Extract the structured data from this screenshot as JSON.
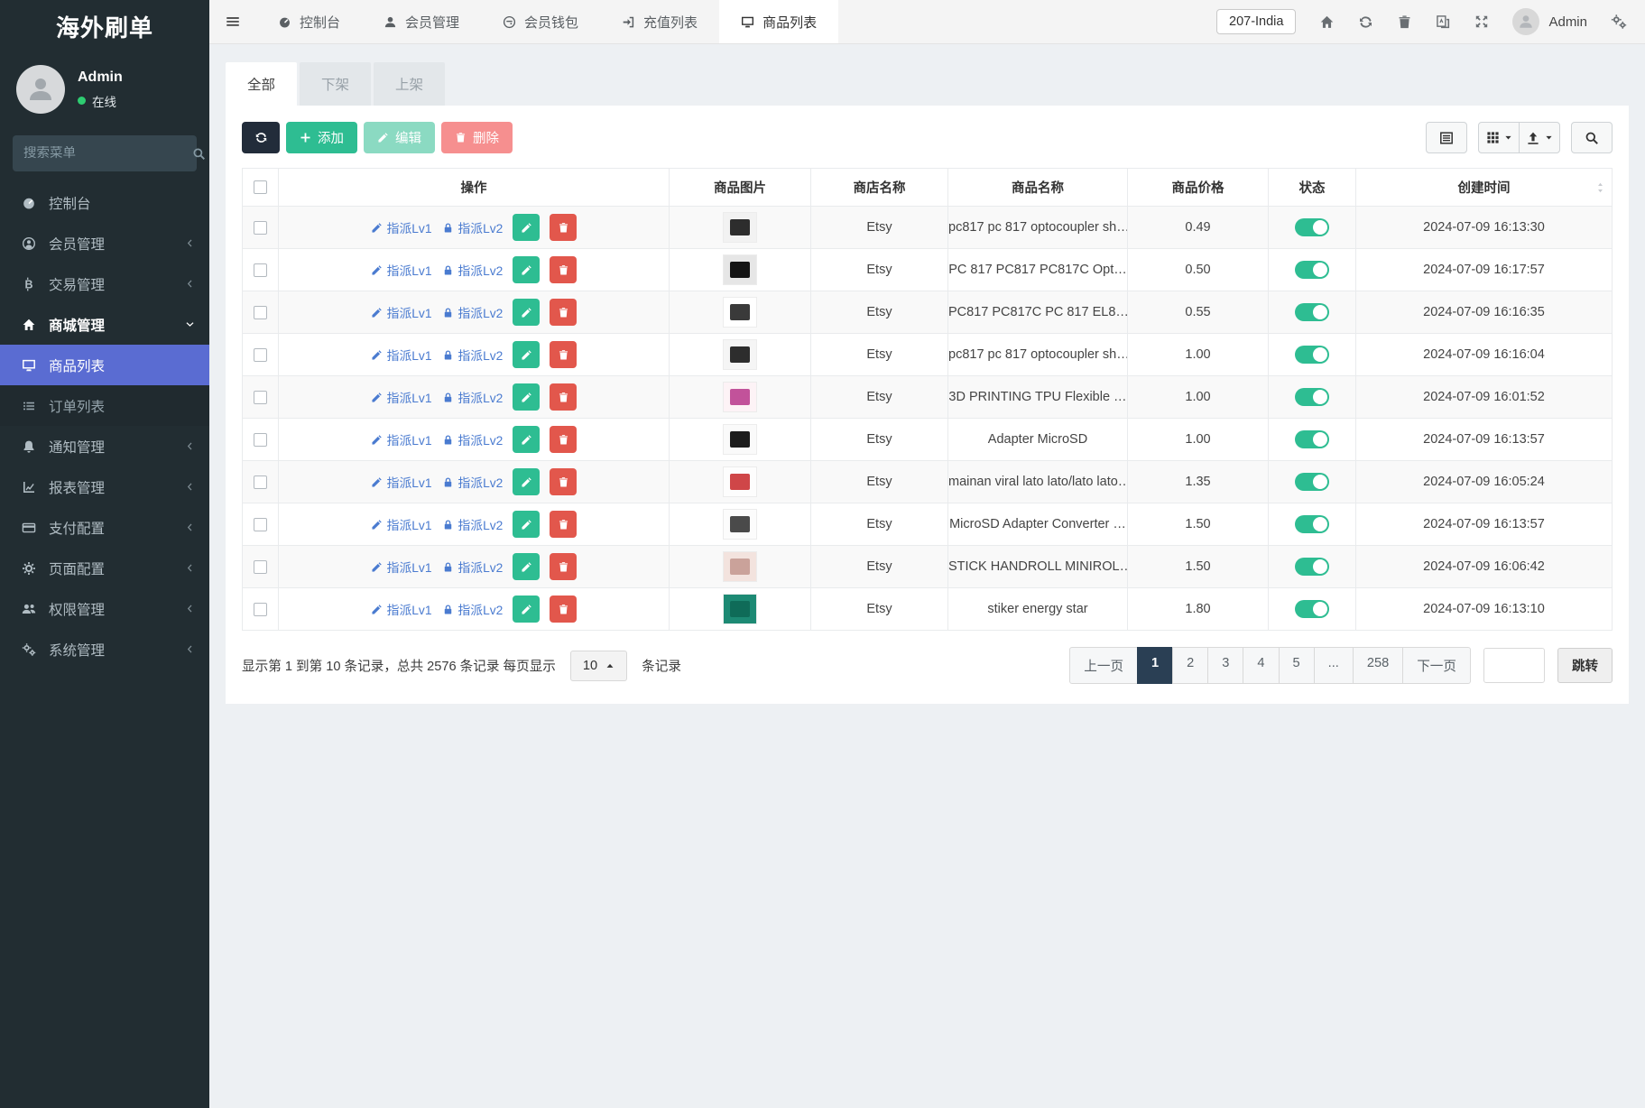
{
  "app": {
    "title": "海外刷单"
  },
  "sidebar": {
    "user": {
      "name": "Admin",
      "status": "在线"
    },
    "search_placeholder": "搜索菜单",
    "items": [
      {
        "label": "控制台",
        "icon": "speedometer-icon"
      },
      {
        "label": "会员管理",
        "icon": "user-circle-icon",
        "chevron": true
      },
      {
        "label": "交易管理",
        "icon": "bitcoin-icon",
        "chevron": true
      },
      {
        "label": "商城管理",
        "icon": "home-icon",
        "expanded": true
      },
      {
        "label": "商品列表",
        "icon": "desktop-icon",
        "active": true
      },
      {
        "label": "订单列表",
        "icon": "list-icon",
        "dim": true
      },
      {
        "label": "通知管理",
        "icon": "bell-icon",
        "chevron": true
      },
      {
        "label": "报表管理",
        "icon": "chart-icon",
        "chevron": true
      },
      {
        "label": "支付配置",
        "icon": "credit-card-icon",
        "chevron": true
      },
      {
        "label": "页面配置",
        "icon": "gear-icon",
        "chevron": true
      },
      {
        "label": "权限管理",
        "icon": "users-icon",
        "chevron": true
      },
      {
        "label": "系统管理",
        "icon": "cogs-icon",
        "chevron": true
      }
    ]
  },
  "topbar": {
    "tabs": [
      {
        "label": "控制台",
        "icon": "speedometer-icon"
      },
      {
        "label": "会员管理",
        "icon": "user-icon"
      },
      {
        "label": "会员钱包",
        "icon": "wallet-icon"
      },
      {
        "label": "充值列表",
        "icon": "signin-icon"
      },
      {
        "label": "商品列表",
        "icon": "desktop-icon",
        "active": true
      }
    ],
    "region": "207-India",
    "user": "Admin"
  },
  "content": {
    "filter_tabs": [
      {
        "label": "全部",
        "active": true
      },
      {
        "label": "下架"
      },
      {
        "label": "上架"
      }
    ],
    "toolbar": {
      "add": "添加",
      "edit": "编辑",
      "delete": "删除"
    },
    "table": {
      "columns": [
        "操作",
        "商品图片",
        "商店名称",
        "商品名称",
        "商品价格",
        "状态",
        "创建时间"
      ],
      "action_labels": {
        "assign1": "指派Lv1",
        "assign2": "指派Lv2"
      },
      "rows": [
        {
          "store": "Etsy",
          "name": "pc817 pc 817 optocoupler sh…",
          "price": "0.49",
          "status": "on",
          "created": "2024-07-09 16:13:30",
          "thumb_bg": "#f2f2f2",
          "thumb_fg": "#2d2d2d"
        },
        {
          "store": "Etsy",
          "name": "PC 817 PC817 PC817C Opt…",
          "price": "0.50",
          "status": "on",
          "created": "2024-07-09 16:17:57",
          "thumb_bg": "#e6e6e6",
          "thumb_fg": "#141414"
        },
        {
          "store": "Etsy",
          "name": "PC817 PC817C PC 817 EL8…",
          "price": "0.55",
          "status": "on",
          "created": "2024-07-09 16:16:35",
          "thumb_bg": "#ffffff",
          "thumb_fg": "#3a3a3a"
        },
        {
          "store": "Etsy",
          "name": "pc817 pc 817 optocoupler sh…",
          "price": "1.00",
          "status": "on",
          "created": "2024-07-09 16:16:04",
          "thumb_bg": "#f5f5f5",
          "thumb_fg": "#2d2d2d"
        },
        {
          "store": "Etsy",
          "name": "3D PRINTING TPU Flexible …",
          "price": "1.00",
          "status": "on",
          "created": "2024-07-09 16:01:52",
          "thumb_bg": "#fdf3f6",
          "thumb_fg": "#c2529a"
        },
        {
          "store": "Etsy",
          "name": "Adapter MicroSD",
          "price": "1.00",
          "status": "on",
          "created": "2024-07-09 16:13:57",
          "thumb_bg": "#fafafa",
          "thumb_fg": "#1c1c1c"
        },
        {
          "store": "Etsy",
          "name": "mainan viral lato lato/lato lato…",
          "price": "1.35",
          "status": "on",
          "created": "2024-07-09 16:05:24",
          "thumb_bg": "#fdfdfd",
          "thumb_fg": "#cf4648"
        },
        {
          "store": "Etsy",
          "name": "MicroSD Adapter Converter …",
          "price": "1.50",
          "status": "on",
          "created": "2024-07-09 16:13:57",
          "thumb_bg": "#fcfcfc",
          "thumb_fg": "#4a4a4a"
        },
        {
          "store": "Etsy",
          "name": "STICK HANDROLL MINIROL…",
          "price": "1.50",
          "status": "on",
          "created": "2024-07-09 16:06:42",
          "thumb_bg": "#f3e3de",
          "thumb_fg": "#caa29a"
        },
        {
          "store": "Etsy",
          "name": "stiker energy star",
          "price": "1.80",
          "status": "on",
          "created": "2024-07-09 16:13:10",
          "thumb_bg": "#1d8a74",
          "thumb_fg": "#0f6b58"
        }
      ]
    },
    "footer": {
      "summary_prefix": "显示第 1 到第 10 条记录，总共 2576 条记录 每页显示",
      "page_size": "10",
      "summary_suffix": "条记录",
      "pages": [
        {
          "label": "上一页"
        },
        {
          "label": "1",
          "active": true
        },
        {
          "label": "2"
        },
        {
          "label": "3"
        },
        {
          "label": "4"
        },
        {
          "label": "5"
        },
        {
          "label": "..."
        },
        {
          "label": "258"
        },
        {
          "label": "下一页"
        }
      ],
      "jump_label": "跳转"
    }
  },
  "colors": {
    "accent_green": "#2ebd92",
    "accent_red": "#e2574c",
    "active_menu": "#5a6cd2",
    "pager_active": "#2a3f54"
  }
}
